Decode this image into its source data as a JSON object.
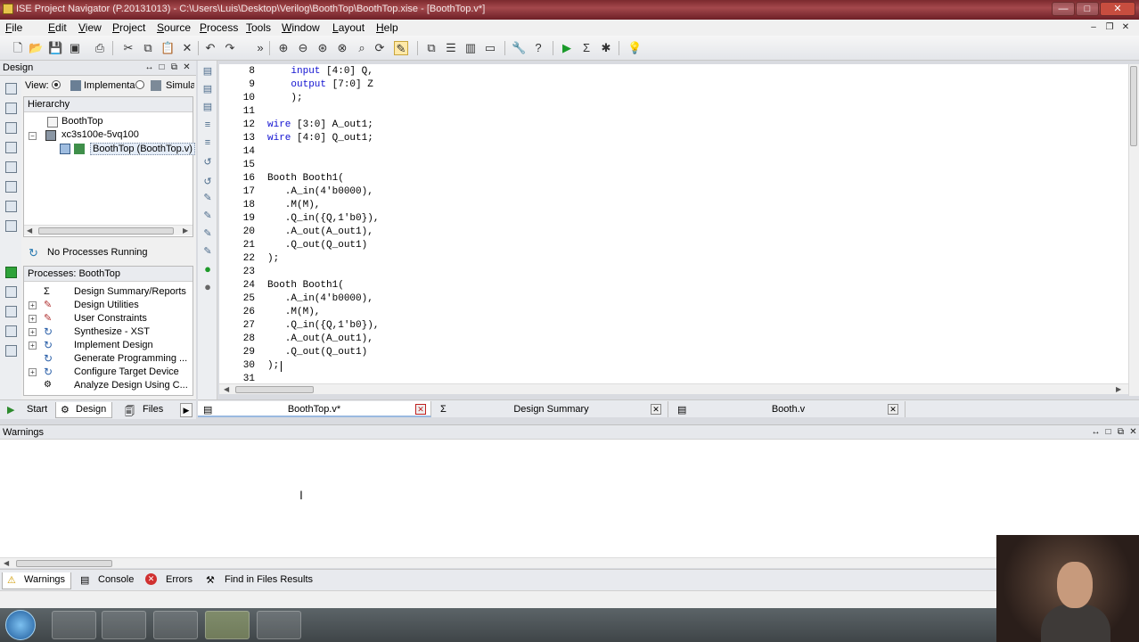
{
  "window": {
    "title": "ISE Project Navigator (P.20131013) - C:\\Users\\Luis\\Desktop\\Verilog\\BoothTop\\BoothTop.xise - [BoothTop.v*]",
    "min": "—",
    "max": "□",
    "close": "✕"
  },
  "menubar": [
    "File",
    "Edit",
    "View",
    "Project",
    "Source",
    "Process",
    "Tools",
    "Window",
    "Layout",
    "Help"
  ],
  "design_panel": {
    "title": "Design",
    "view_label": "View:",
    "view_options": [
      "Implementa",
      "Simulat"
    ],
    "hierarchy_label": "Hierarchy",
    "tree": [
      "BoothTop",
      "xc3s100e-5vq100",
      "BoothTop (BoothTop.v)"
    ],
    "process_status": "No Processes Running",
    "processes_label": "Processes: BoothTop",
    "processes": [
      "Design Summary/Reports",
      "Design Utilities",
      "User Constraints",
      "Synthesize - XST",
      "Implement Design",
      "Generate Programming ...",
      "Configure Target Device",
      "Analyze Design Using C..."
    ]
  },
  "editor": {
    "lines": [
      {
        "n": "8",
        "code": "    input [4:0] Q,"
      },
      {
        "n": "9",
        "code": "    output [7:0] Z"
      },
      {
        "n": "10",
        "code": "    );"
      },
      {
        "n": "11",
        "code": ""
      },
      {
        "n": "12",
        "code": "wire [3:0] A_out1;"
      },
      {
        "n": "13",
        "code": "wire [4:0] Q_out1;"
      },
      {
        "n": "14",
        "code": ""
      },
      {
        "n": "15",
        "code": ""
      },
      {
        "n": "16",
        "code": "Booth Booth1("
      },
      {
        "n": "17",
        "code": "   .A_in(4'b0000),"
      },
      {
        "n": "18",
        "code": "   .M(M),"
      },
      {
        "n": "19",
        "code": "   .Q_in({Q,1'b0}),"
      },
      {
        "n": "20",
        "code": "   .A_out(A_out1),"
      },
      {
        "n": "21",
        "code": "   .Q_out(Q_out1)"
      },
      {
        "n": "22",
        "code": ");"
      },
      {
        "n": "23",
        "code": ""
      },
      {
        "n": "24",
        "code": "Booth Booth1("
      },
      {
        "n": "25",
        "code": "   .A_in(4'b0000),"
      },
      {
        "n": "26",
        "code": "   .M(M),"
      },
      {
        "n": "27",
        "code": "   .Q_in({Q,1'b0}),"
      },
      {
        "n": "28",
        "code": "   .A_out(A_out1),"
      },
      {
        "n": "29",
        "code": "   .Q_out(Q_out1)"
      },
      {
        "n": "30",
        "code": ");"
      },
      {
        "n": "31",
        "code": ""
      }
    ]
  },
  "left_tabs": [
    "Start",
    "Design",
    "Files"
  ],
  "doc_tabs": [
    "BoothTop.v*",
    "Design Summary",
    "Booth.v"
  ],
  "warnings_panel": {
    "title": "Warnings"
  },
  "bottom_tabs": [
    "Warnings",
    "Console",
    "Errors",
    "Find in Files Results"
  ]
}
